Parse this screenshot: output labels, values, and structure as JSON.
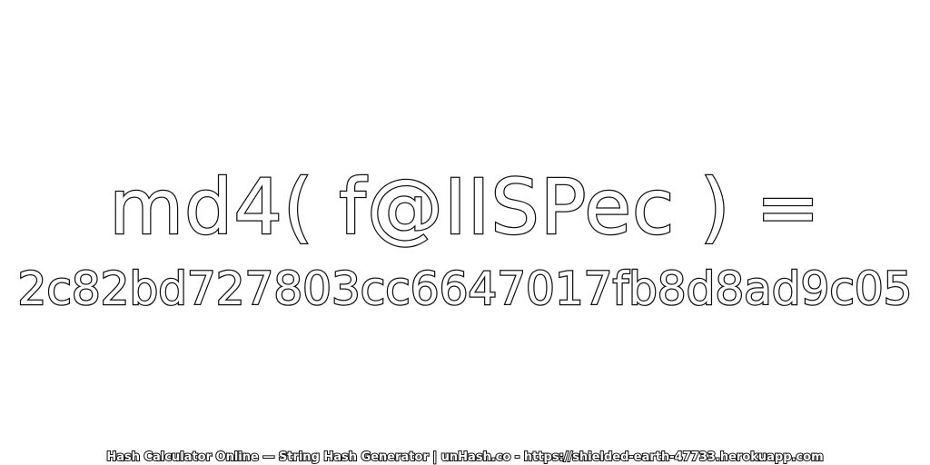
{
  "expression": "md4( f@IISPec ) =",
  "hash_value": "2c82bd727803cc6647017fb8d8ad9c05",
  "footer": "Hash Calculator Online — String Hash Generator | unHash.co - https://shielded-earth-47733.herokuapp.com",
  "colors": {
    "background": "#ffffff",
    "text_fill": "#ffffff",
    "text_stroke": "#111111"
  }
}
